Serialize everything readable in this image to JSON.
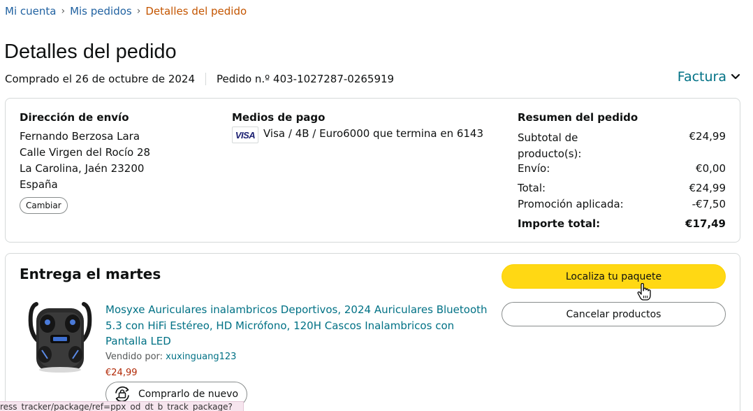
{
  "breadcrumb": {
    "items": [
      "Mi cuenta",
      "Mis pedidos"
    ],
    "separator": "›",
    "current": "Detalles del pedido"
  },
  "page": {
    "title": "Detalles del pedido",
    "purchased": "Comprado el 26 de octubre de 2024",
    "order_number": "Pedido n.º 403-1027287-0265919",
    "invoice_label": "Factura"
  },
  "shipping": {
    "heading": "Dirección de envío",
    "lines": [
      "Fernando Berzosa Lara",
      "Calle Virgen del Rocío 28",
      "La Carolina, Jaén 23200",
      "España"
    ],
    "change_button": "Cambiar"
  },
  "payment": {
    "heading": "Medios de pago",
    "card_brand": "VISA",
    "method": "Visa / 4B / Euro6000  que termina en 6143"
  },
  "summary": {
    "heading": "Resumen del pedido",
    "rows": [
      {
        "label_1": "Subtotal de",
        "label_2": "producto(s):",
        "value": "€24,99"
      },
      {
        "label": "Envío:",
        "value": "€0,00"
      },
      {
        "label": "Total:",
        "value": "€24,99"
      },
      {
        "label": "Promoción aplicada:",
        "value": "-€7,50"
      },
      {
        "label": "Importe total:",
        "value": "€17,49"
      }
    ]
  },
  "delivery": {
    "heading": "Entrega el martes",
    "track_button": "Localiza tu paquete",
    "cancel_button": "Cancelar productos",
    "product": {
      "title": "Mosyxe Auriculares inalambricos Deportivos, 2024 Auriculares Bluetooth 5.3 con HiFi Estéreo, HD Micrófono, 120H Cascos Inalambricos con Pantalla LED",
      "sold_by_label": "Vendido por:",
      "seller": "xuxinguang123",
      "price": "€24,99",
      "rebuy_button": "Comprarlo de nuevo"
    }
  },
  "status_bar": {
    "url": "ress_tracker/package/ref=ppx_od_dt_b_track_package?"
  },
  "colors": {
    "link": "#007185",
    "breadcrumb_current": "#c45500",
    "price": "#b12704",
    "primary_button": "#ffd814"
  }
}
